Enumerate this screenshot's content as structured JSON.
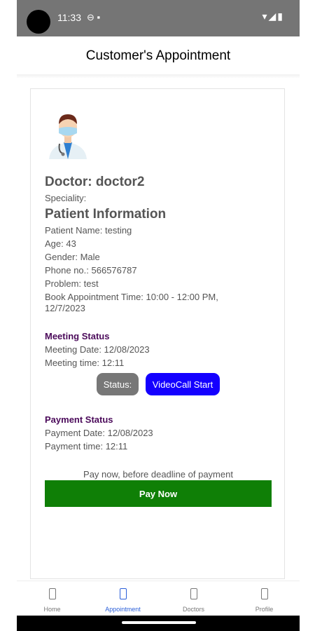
{
  "statusbar": {
    "time": "11:33",
    "left_icons": "⊖ ▪",
    "right_icons": "▾◢▮"
  },
  "appbar": {
    "title": "Customer's Appointment"
  },
  "appointment": {
    "doctor": "Doctor: doctor2",
    "speciality": "Speciality:",
    "patient_section_title": "Patient Information",
    "patient_name": "Patient Name: testing",
    "age": "Age: 43",
    "gender": "Gender: Male",
    "phone": "Phone no.: 566576787",
    "problem": "Problem: test",
    "book_time_line1": "Book Appointment Time: 10:00 - 12:00 PM,",
    "book_time_line2": "12/7/2023"
  },
  "meeting": {
    "title": "Meeting Status",
    "date": "Meeting Date: 12/08/2023",
    "time": "Meeting time: 12:11",
    "status_label": "Status:",
    "video_button": "VideoCall Start"
  },
  "payment": {
    "title": "Payment Status",
    "date": "Payment Date: 12/08/2023",
    "time": "Payment time: 12:11",
    "note": "Pay now, before deadline of payment",
    "pay_button": "Pay Now"
  },
  "bottom_nav": {
    "items": [
      {
        "label": "Home",
        "icon": "home-icon"
      },
      {
        "label": "Appointment",
        "icon": "appointment-icon"
      },
      {
        "label": "Doctors",
        "icon": "doctors-icon"
      },
      {
        "label": "Profile",
        "icon": "profile-icon"
      }
    ],
    "active_index": 1
  },
  "colors": {
    "statusbar_bg": "#757575",
    "section_title": "#4b0a5a",
    "status_btn": "#777777",
    "video_btn": "#1400ff",
    "pay_btn": "#0f7f06",
    "nav_active": "#2b5fd9"
  }
}
